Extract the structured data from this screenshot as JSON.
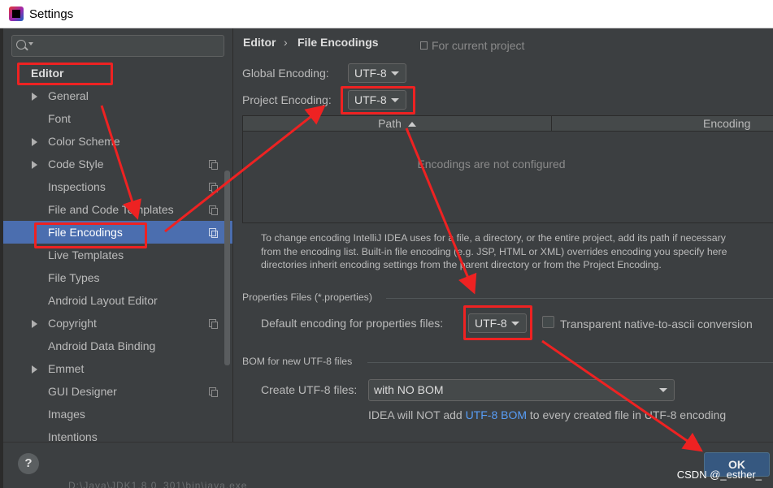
{
  "window": {
    "title": "Settings"
  },
  "search": {
    "placeholder": "",
    "value": ""
  },
  "sidebar": {
    "items": [
      {
        "label": "Editor",
        "level": 0,
        "expand": false,
        "project_icon": false,
        "selected": false
      },
      {
        "label": "General",
        "level": 1,
        "expand": true,
        "project_icon": false,
        "selected": false
      },
      {
        "label": "Font",
        "level": 1,
        "expand": false,
        "project_icon": false,
        "selected": false
      },
      {
        "label": "Color Scheme",
        "level": 1,
        "expand": true,
        "project_icon": false,
        "selected": false
      },
      {
        "label": "Code Style",
        "level": 1,
        "expand": true,
        "project_icon": true,
        "selected": false
      },
      {
        "label": "Inspections",
        "level": 1,
        "expand": false,
        "project_icon": true,
        "selected": false
      },
      {
        "label": "File and Code Templates",
        "level": 1,
        "expand": false,
        "project_icon": true,
        "selected": false
      },
      {
        "label": "File Encodings",
        "level": 1,
        "expand": false,
        "project_icon": true,
        "selected": true
      },
      {
        "label": "Live Templates",
        "level": 1,
        "expand": false,
        "project_icon": false,
        "selected": false
      },
      {
        "label": "File Types",
        "level": 1,
        "expand": false,
        "project_icon": false,
        "selected": false
      },
      {
        "label": "Android Layout Editor",
        "level": 1,
        "expand": false,
        "project_icon": false,
        "selected": false
      },
      {
        "label": "Copyright",
        "level": 1,
        "expand": true,
        "project_icon": true,
        "selected": false
      },
      {
        "label": "Android Data Binding",
        "level": 1,
        "expand": false,
        "project_icon": false,
        "selected": false
      },
      {
        "label": "Emmet",
        "level": 1,
        "expand": true,
        "project_icon": false,
        "selected": false
      },
      {
        "label": "GUI Designer",
        "level": 1,
        "expand": false,
        "project_icon": true,
        "selected": false
      },
      {
        "label": "Images",
        "level": 1,
        "expand": false,
        "project_icon": false,
        "selected": false
      },
      {
        "label": "Intentions",
        "level": 1,
        "expand": false,
        "project_icon": false,
        "selected": false
      }
    ]
  },
  "main": {
    "breadcrumb": {
      "parent": "Editor",
      "separator": "›",
      "current": "File Encodings"
    },
    "for_current_project": "For current project",
    "global_encoding": {
      "label": "Global Encoding:",
      "value": "UTF-8"
    },
    "project_encoding": {
      "label": "Project Encoding:",
      "value": "UTF-8"
    },
    "table": {
      "columns": [
        "Path",
        "Encoding"
      ],
      "empty_text": "Encodings are not configured"
    },
    "help_lines": [
      "To change encoding IntelliJ IDEA uses for a file, a directory, or the entire project, add its path if necessary",
      "from the encoding list. Built-in file encoding (e.g. JSP, HTML or XML) overrides encoding you specify here",
      "directories inherit encoding settings from the parent directory or from the Project Encoding."
    ],
    "properties": {
      "section_title": "Properties Files (*.properties)",
      "default_label": "Default encoding for properties files:",
      "default_value": "UTF-8",
      "transparent_label": "Transparent native-to-ascii conversion",
      "transparent_checked": false
    },
    "bom": {
      "section_title": "BOM for new UTF-8 files",
      "create_label": "Create UTF-8 files:",
      "create_value": "with NO BOM",
      "note_before": "IDEA will NOT add ",
      "note_link": "UTF-8 BOM",
      "note_after": " to every created file in UTF-8 encoding"
    }
  },
  "footer": {
    "help_label": "?",
    "ok_label": "OK",
    "background_peek": "D:\\Java\\JDK1.8.0_301\\bin\\java.exe",
    "watermark": "CSDN @_esther_"
  },
  "colors": {
    "annotation": "#ee2222",
    "selection": "#4b6eaf",
    "panel": "#3c3f41",
    "ok_button": "#365880",
    "link": "#589df6"
  }
}
